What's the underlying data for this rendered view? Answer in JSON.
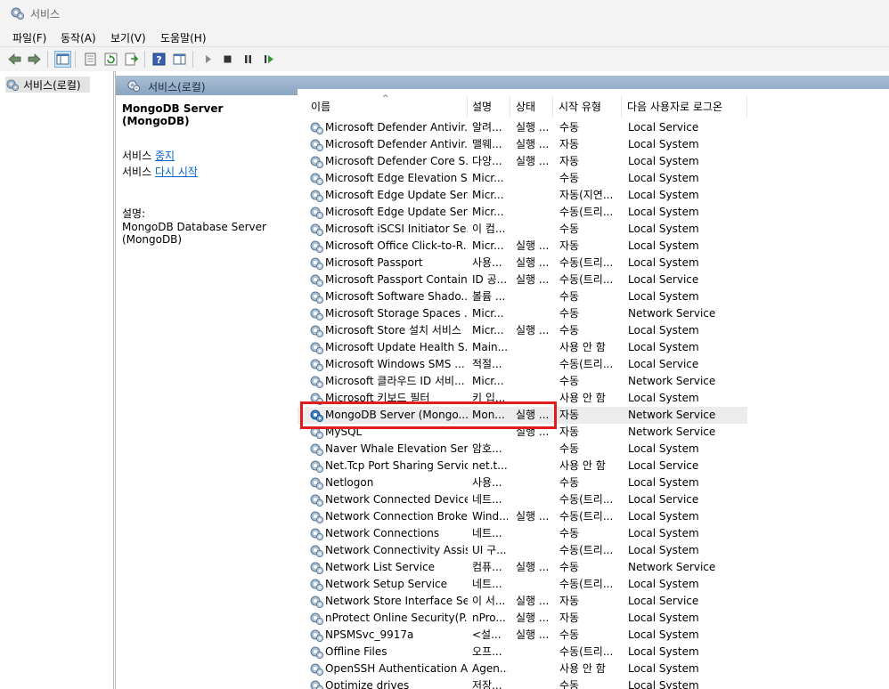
{
  "window": {
    "title": "서비스"
  },
  "menu": [
    "파일(F)",
    "동작(A)",
    "보기(V)",
    "도움말(H)"
  ],
  "toolbar": [
    "back-icon",
    "forward-icon",
    "show-hide-console-tree-icon",
    "properties-icon",
    "refresh-icon",
    "export-list-icon",
    "help-icon",
    "show-action-pane-icon",
    "start-service-icon",
    "stop-service-icon",
    "pause-service-icon",
    "restart-service-icon"
  ],
  "tree": {
    "item": "서비스(로컬)"
  },
  "band": {
    "title": "서비스(로컬)"
  },
  "details": {
    "service_title": "MongoDB Server (MongoDB)",
    "action_prefix_1": "서비스 ",
    "action_link_1": "중지",
    "action_prefix_2": "서비스 ",
    "action_link_2": "다시 시작",
    "desc_label": "설명:",
    "desc_text": "MongoDB Database Server (MongoDB)"
  },
  "columns": [
    "이름",
    "설명",
    "상태",
    "시작 유형",
    "다음 사용자로 로그온"
  ],
  "rows": [
    {
      "name": "Microsoft Defender Antivir...",
      "desc": "알려...",
      "status": "실행 ...",
      "start": "수동",
      "logon": "Local Service"
    },
    {
      "name": "Microsoft Defender Antivir...",
      "desc": "맬웨...",
      "status": "실행 ...",
      "start": "자동",
      "logon": "Local System"
    },
    {
      "name": "Microsoft Defender Core S...",
      "desc": "다양...",
      "status": "실행 ...",
      "start": "자동",
      "logon": "Local System"
    },
    {
      "name": "Microsoft Edge Elevation S...",
      "desc": "Micr...",
      "status": "",
      "start": "수동",
      "logon": "Local System"
    },
    {
      "name": "Microsoft Edge Update Ser...",
      "desc": "Micr...",
      "status": "",
      "start": "자동(지연...",
      "logon": "Local System"
    },
    {
      "name": "Microsoft Edge Update Ser...",
      "desc": "Micr...",
      "status": "",
      "start": "수동(트리...",
      "logon": "Local System"
    },
    {
      "name": "Microsoft iSCSI Initiator Se...",
      "desc": "이 컴...",
      "status": "",
      "start": "수동",
      "logon": "Local System"
    },
    {
      "name": "Microsoft Office Click-to-R...",
      "desc": "Micr...",
      "status": "실행 ...",
      "start": "자동",
      "logon": "Local System"
    },
    {
      "name": "Microsoft Passport",
      "desc": "사용...",
      "status": "실행 ...",
      "start": "수동(트리...",
      "logon": "Local System"
    },
    {
      "name": "Microsoft Passport Container",
      "desc": "ID 공...",
      "status": "실행 ...",
      "start": "수동(트리...",
      "logon": "Local Service"
    },
    {
      "name": "Microsoft Software Shado...",
      "desc": "볼륨 ...",
      "status": "",
      "start": "수동",
      "logon": "Local System"
    },
    {
      "name": "Microsoft Storage Spaces ...",
      "desc": "Micr...",
      "status": "",
      "start": "수동",
      "logon": "Network Service"
    },
    {
      "name": "Microsoft Store 설치 서비스",
      "desc": "Micr...",
      "status": "실행 ...",
      "start": "수동",
      "logon": "Local System"
    },
    {
      "name": "Microsoft Update Health S...",
      "desc": "Main...",
      "status": "",
      "start": "사용 안 함",
      "logon": "Local System"
    },
    {
      "name": "Microsoft Windows SMS ...",
      "desc": "적절...",
      "status": "",
      "start": "수동(트리...",
      "logon": "Local Service"
    },
    {
      "name": "Microsoft 클라우드 ID 서비...",
      "desc": "Micr...",
      "status": "",
      "start": "수동",
      "logon": "Network Service"
    },
    {
      "name": "Microsoft 키보드 필터",
      "desc": "키 입...",
      "status": "",
      "start": "사용 안 함",
      "logon": "Local System"
    },
    {
      "name": "MongoDB Server (Mongo...",
      "desc": "Mon...",
      "status": "실행 ...",
      "start": "자동",
      "logon": "Network Service",
      "selected": true
    },
    {
      "name": "MySQL",
      "desc": "",
      "status": "실행 ...",
      "start": "자동",
      "logon": "Network Service"
    },
    {
      "name": "Naver Whale Elevation Serv...",
      "desc": "암호...",
      "status": "",
      "start": "수동",
      "logon": "Local System"
    },
    {
      "name": "Net.Tcp Port Sharing Service",
      "desc": "net.t...",
      "status": "",
      "start": "사용 안 함",
      "logon": "Local Service"
    },
    {
      "name": "Netlogon",
      "desc": "사용...",
      "status": "",
      "start": "수동",
      "logon": "Local System"
    },
    {
      "name": "Network Connected Device...",
      "desc": "네트...",
      "status": "",
      "start": "수동(트리...",
      "logon": "Local Service"
    },
    {
      "name": "Network Connection Broker",
      "desc": "Wind...",
      "status": "실행 ...",
      "start": "수동(트리...",
      "logon": "Local System"
    },
    {
      "name": "Network Connections",
      "desc": "네트...",
      "status": "",
      "start": "수동",
      "logon": "Local System"
    },
    {
      "name": "Network Connectivity Assis...",
      "desc": "UI 구...",
      "status": "",
      "start": "수동(트리...",
      "logon": "Local System"
    },
    {
      "name": "Network List Service",
      "desc": "컴퓨...",
      "status": "실행 ...",
      "start": "수동",
      "logon": "Network Service"
    },
    {
      "name": "Network Setup Service",
      "desc": "네트...",
      "status": "",
      "start": "수동(트리...",
      "logon": "Local System"
    },
    {
      "name": "Network Store Interface Se...",
      "desc": "이 서...",
      "status": "실행 ...",
      "start": "자동",
      "logon": "Local Service"
    },
    {
      "name": "nProtect Online Security(P...",
      "desc": "nPro...",
      "status": "실행 ...",
      "start": "자동",
      "logon": "Local System"
    },
    {
      "name": "NPSMSvc_9917a",
      "desc": "<설...",
      "status": "실행 ...",
      "start": "수동",
      "logon": "Local System"
    },
    {
      "name": "Offline Files",
      "desc": "오프...",
      "status": "",
      "start": "수동(트리...",
      "logon": "Local System"
    },
    {
      "name": "OpenSSH Authentication A...",
      "desc": "Agen...",
      "status": "",
      "start": "사용 안 함",
      "logon": "Local System"
    },
    {
      "name": "Optimize drives",
      "desc": "저장...",
      "status": "",
      "start": "수동",
      "logon": "Local System"
    }
  ]
}
